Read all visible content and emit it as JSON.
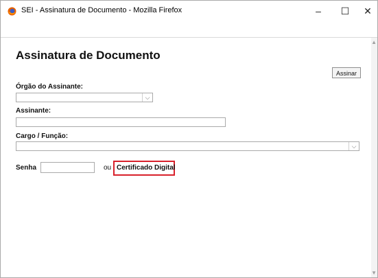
{
  "window": {
    "title": "SEI - Assinatura de Documento - Mozilla Firefox",
    "minimize_label": "–",
    "maximize_label": "☐",
    "close_label": "✕"
  },
  "page": {
    "title": "Assinatura de Documento",
    "sign_button": "Assinar"
  },
  "form": {
    "orgao_label": "Órgão do Assinante:",
    "orgao_value": "",
    "assinante_label": "Assinante:",
    "assinante_value": "",
    "cargo_label": "Cargo / Função:",
    "cargo_value": "",
    "senha_label": "Senha",
    "senha_value": "",
    "ou_text": "ou",
    "certificado_label": "Certificado Digital"
  },
  "colors": {
    "highlight": "#d8202a",
    "firefox_orange": "#e66000"
  },
  "icons": {
    "app": "firefox-icon",
    "dropdown": "chevron-down-icon"
  }
}
